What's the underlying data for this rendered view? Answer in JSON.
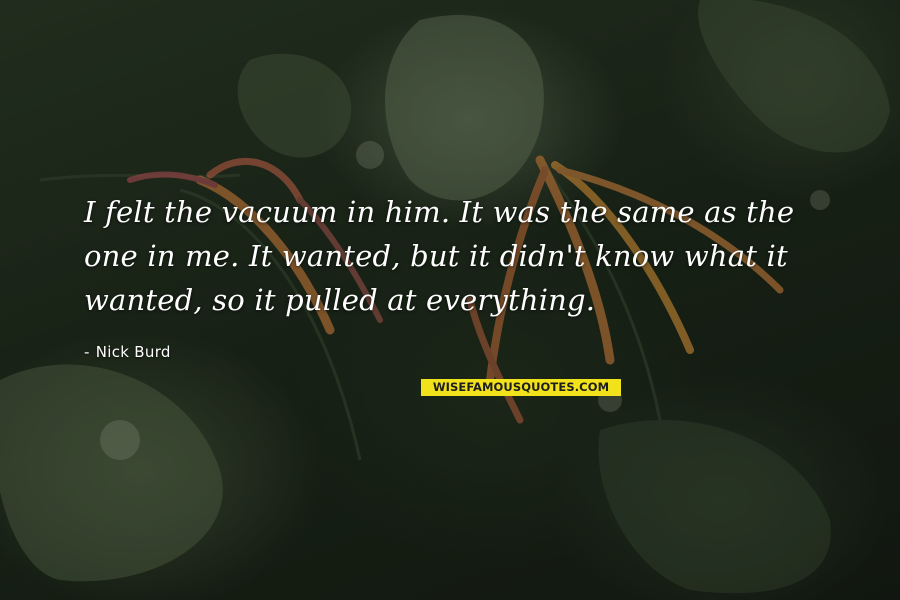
{
  "quote": {
    "lines": [
      "I felt the vacuum in him. It was the same as the",
      "one in me. It wanted, but it didn't know what it",
      "wanted, so it pulled at everything."
    ]
  },
  "author": {
    "dash": "-",
    "name": "Nick Burd"
  },
  "watermark": {
    "text": "WISEFAMOUSQUOTES.COM"
  },
  "colors": {
    "text": "#ffffff",
    "watermark_bg": "#f2e21b",
    "watermark_text": "#1e1e1e",
    "flower": "#d9863f"
  }
}
